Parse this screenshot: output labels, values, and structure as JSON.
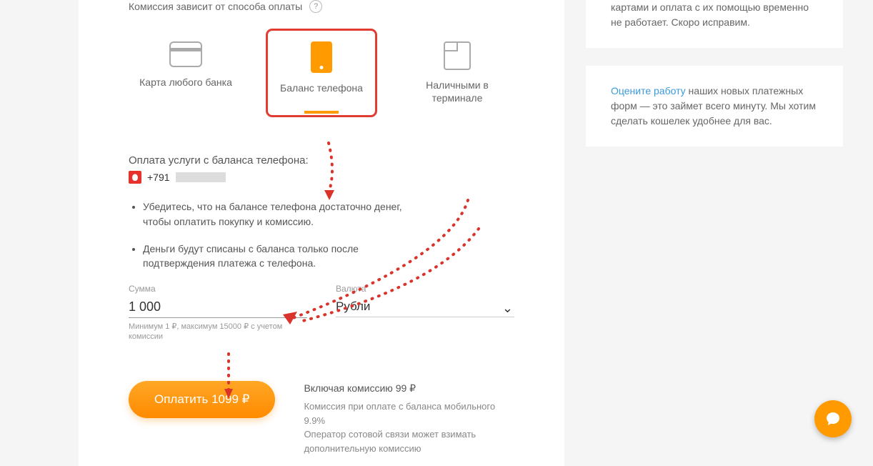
{
  "header": {
    "commission_note": "Комиссия зависит от способа оплаты",
    "help_symbol": "?"
  },
  "methods": {
    "card": "Карта любого банка",
    "phone": "Баланс телефона",
    "cash": "Наличными в терминале"
  },
  "phone_section": {
    "title": "Оплата услуги с баланса телефона:",
    "number_prefix": "+791"
  },
  "bullets": [
    "Убедитесь, что на балансе телефона достаточно денег, чтобы оплатить покупку и комиссию.",
    "Деньги будут списаны с баланса только после подтверждения платежа с телефона."
  ],
  "amount": {
    "label": "Сумма",
    "value": "1 000",
    "hint": "Минимум 1 ₽, максимум 15000 ₽ с учетом комиссии"
  },
  "currency": {
    "label": "Валюта",
    "value": "Рубли"
  },
  "pay_button": "Оплатить 1099 ₽",
  "fees": {
    "including": "Включая комиссию 99 ₽",
    "rate": "Комиссия при оплате с баланса мобильного 9.9%",
    "operator_note": "Оператор сотовой связи может взимать дополнительную комиссию"
  },
  "side": {
    "notice": "картами и оплата с их помощью временно не работает. Скоро исправим.",
    "feedback_link": "Оцените работу",
    "feedback_text": " наших новых платежных форм — это займет всего минуту. Мы хотим сделать кошелек удобнее для вас."
  }
}
